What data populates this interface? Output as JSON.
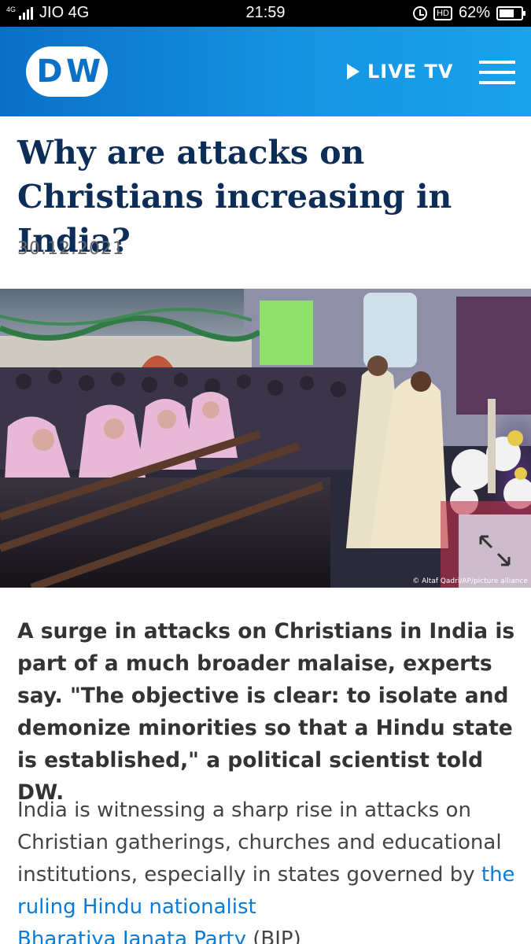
{
  "status_bar": {
    "network_type": "4G",
    "carrier": "JIO 4G",
    "time": "21:59",
    "hd_label": "HD",
    "battery": "62%"
  },
  "header": {
    "logo_left": "D",
    "logo_right": "W",
    "live_tv_label": "LIVE TV"
  },
  "article": {
    "headline": "Why are attacks on Christians increasing in India?",
    "date": "30.12.2021",
    "photo_credit": "© Altaf Qadri/AP/picture alliance",
    "lead": "A surge in attacks on Christians in India is part of a much broader malaise, experts say. \"The objective is clear: to isolate and demonize minorities so that a Hindu state is established,\" a political scientist told DW.",
    "body_before_link": "India is witnessing a sharp rise in attacks on Christian gatherings, churches and educational institutions, especially in states governed by ",
    "body_link_line1": "the ruling Hindu nationalist",
    "body_link_line2": "Bharatiya Janata Party",
    "body_after_link": " (BJP)"
  },
  "colors": {
    "brand_blue": "#0a6fc7",
    "headline_navy": "#0c2d58",
    "link_blue": "#0a7bd6"
  },
  "icons": [
    "signal-icon",
    "alarm-icon",
    "battery-icon",
    "play-icon",
    "menu-icon",
    "expand-icon"
  ]
}
